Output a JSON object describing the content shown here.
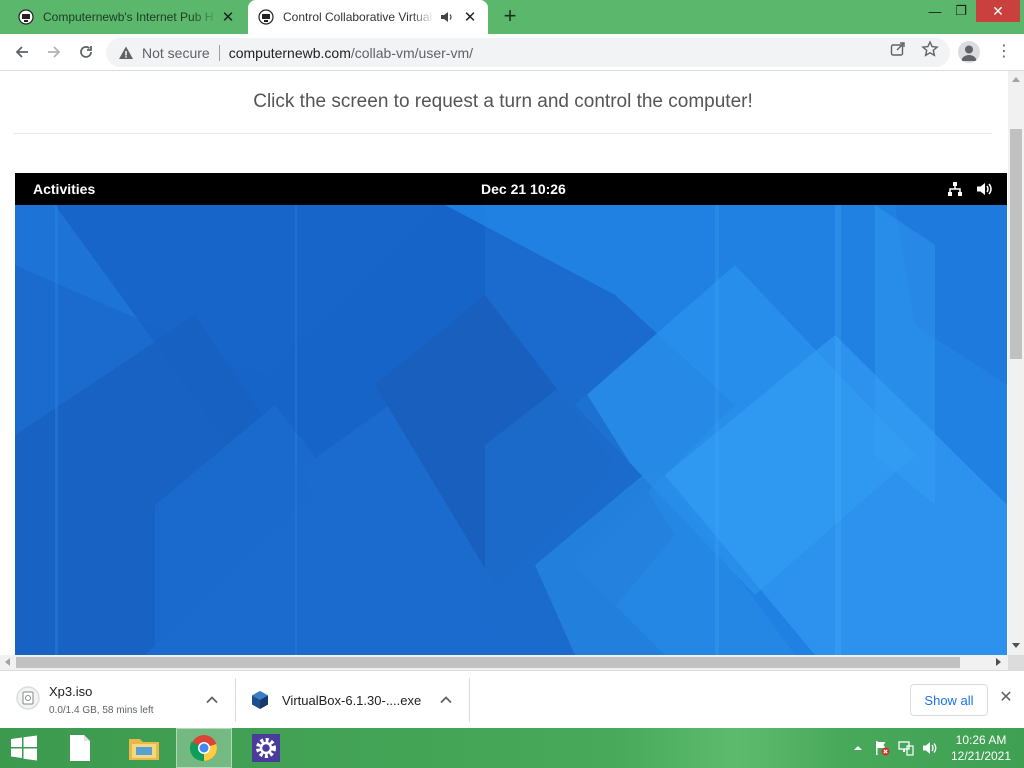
{
  "browser": {
    "tabs": [
      {
        "title": "Computernewb's Internet Pub H",
        "active": false
      },
      {
        "title": "Control Collaborative Virtual",
        "active": true
      }
    ],
    "omnibox": {
      "security": "Not secure",
      "domain": "computernewb.com",
      "path": "/collab-vm/user-vm/"
    }
  },
  "page": {
    "instruction": "Click the screen to request a turn and control the computer!"
  },
  "vm": {
    "topbar": {
      "activities": "Activities",
      "clock": "Dec 21  10:26"
    }
  },
  "downloads": {
    "items": [
      {
        "name": "Xp3.iso",
        "status": "0.0/1.4 GB, 58 mins left"
      },
      {
        "name": "VirtualBox-6.1.30-....exe",
        "status": ""
      }
    ],
    "show_all": "Show all"
  },
  "taskbar": {
    "time": "10:26 AM",
    "date": "12/21/2021"
  },
  "colors": {
    "tabstrip": "#5ab76b",
    "gnome_blue": "#1e6fd0",
    "taskbar": "#48a95a",
    "link_blue": "#1a73e8"
  }
}
